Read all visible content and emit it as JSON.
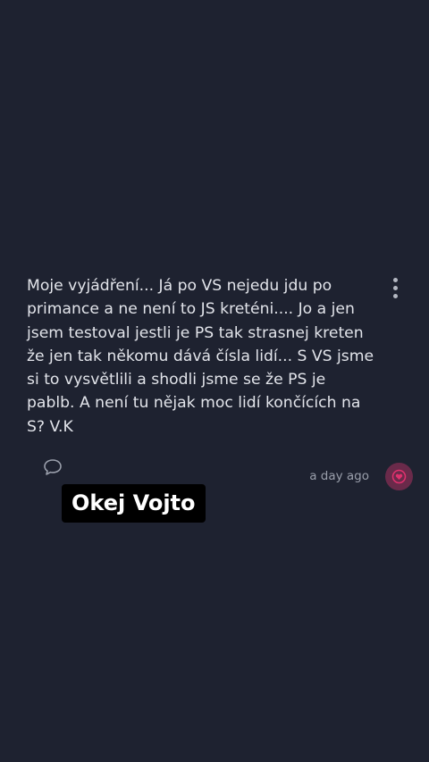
{
  "post": {
    "text": "Moje vyjádření... Já po VS nejedu jdu po primance a ne není to JS kreténi.... Jo a jen jsem testoval jestli je PS tak strasnej kreten že jen tak někomu dává čísla lidí... S VS jsme si to vysvětlili a shodli jsme se že PS je pablb. A není tu nějak moc lidí končících na S? V.K",
    "timestamp": "a day ago",
    "more_icon": "vertical-ellipsis-icon",
    "comment_icon": "speech-bubble-icon",
    "reaction_icon": "heart-icon"
  },
  "caption": {
    "text": "Okej Vojto"
  },
  "colors": {
    "background": "#1e2230",
    "text": "#e2e4ea",
    "muted": "#9a9fab",
    "accent": "#e0316e",
    "caption_bg": "#000000"
  }
}
